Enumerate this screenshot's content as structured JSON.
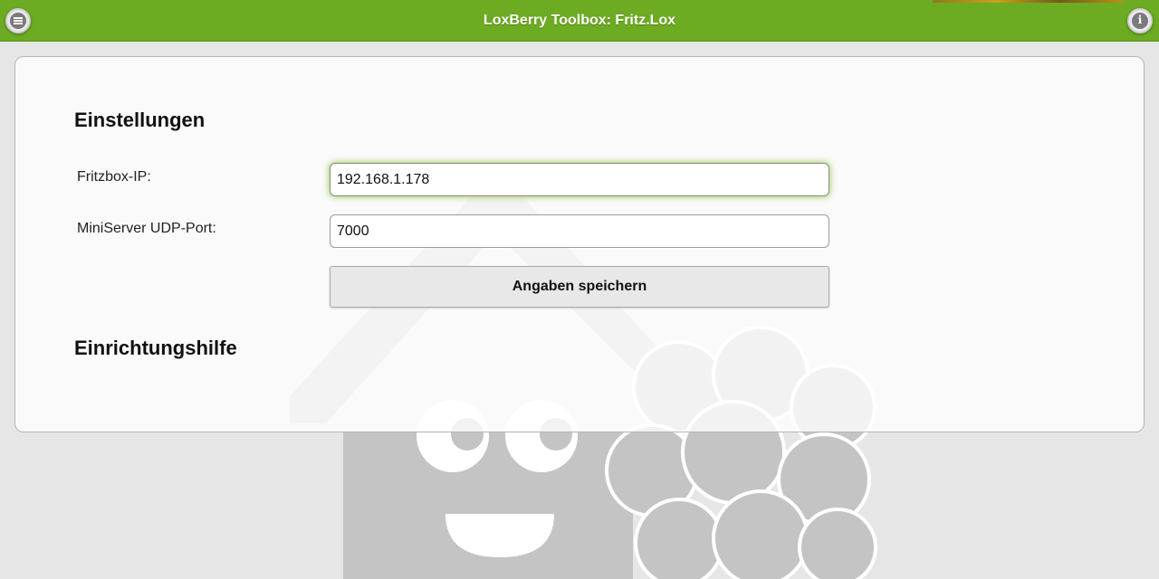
{
  "header": {
    "title": "LoxBerry Toolbox: Fritz.Lox",
    "menu_icon": "menu-icon",
    "info_icon": "info-icon",
    "color": "#6cab22"
  },
  "settings": {
    "heading": "Einstellungen",
    "fritzbox_ip_label": "Fritzbox-IP:",
    "fritzbox_ip_value": "192.168.1.178",
    "udp_port_label": "MiniServer UDP-Port:",
    "udp_port_value": "7000",
    "save_label": "Angaben speichern"
  },
  "help": {
    "heading": "Einrichtungshilfe"
  },
  "background": {
    "logo_icon": "loxberry-logo"
  }
}
